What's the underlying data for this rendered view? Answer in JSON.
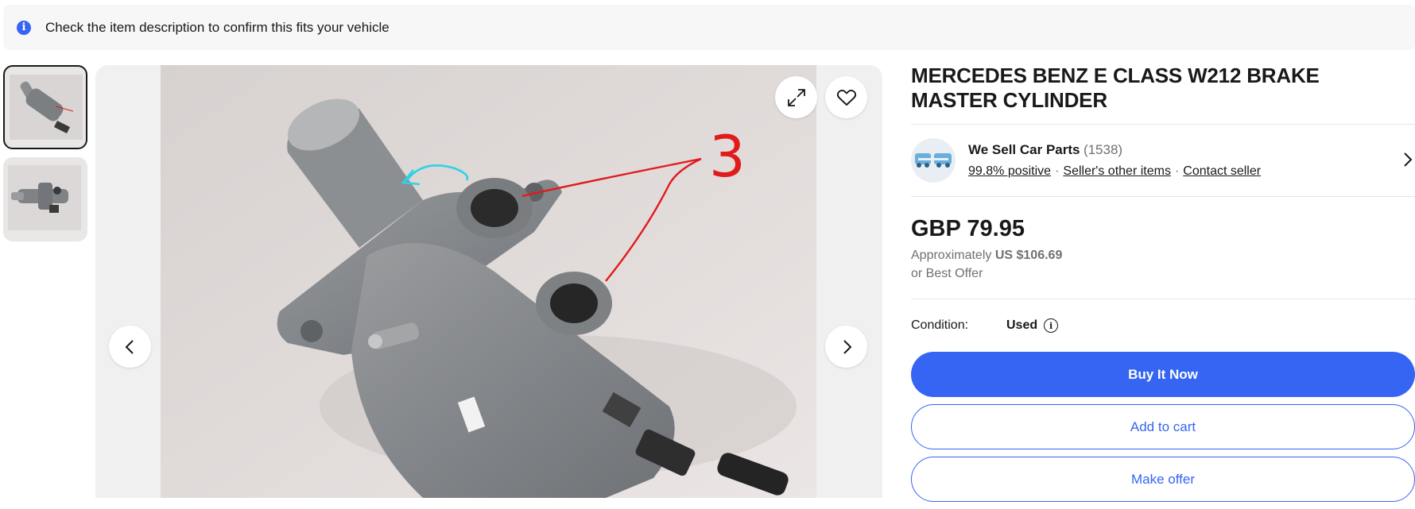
{
  "notice": {
    "text": "Check the item description to confirm this fits your vehicle",
    "icon": "info-icon"
  },
  "gallery": {
    "thumbnail_count": 2,
    "selected_index": 0,
    "icons": [
      "expand-icon",
      "heart-icon",
      "chevron-left-icon",
      "chevron-right-icon"
    ],
    "annotation_text": "3"
  },
  "item": {
    "title": "MERCEDES BENZ E CLASS W212 BRAKE MASTER CYLINDER"
  },
  "seller": {
    "name": "We Sell Car Parts",
    "feedback_count": "(1538)",
    "positive": "99.8% positive",
    "other_items": "Seller's other items",
    "contact": "Contact seller"
  },
  "price": {
    "main": "GBP 79.95",
    "approx_label": "Approximately",
    "approx_value": "US $106.69",
    "offer": "or Best Offer"
  },
  "condition": {
    "label": "Condition:",
    "value": "Used"
  },
  "buttons": {
    "buy_now": "Buy It Now",
    "add_to_cart": "Add to cart",
    "make_offer": "Make offer"
  },
  "colors": {
    "accent": "#3665f3",
    "annotation_red": "#e11b1b",
    "annotation_cyan": "#2fd3e6"
  }
}
